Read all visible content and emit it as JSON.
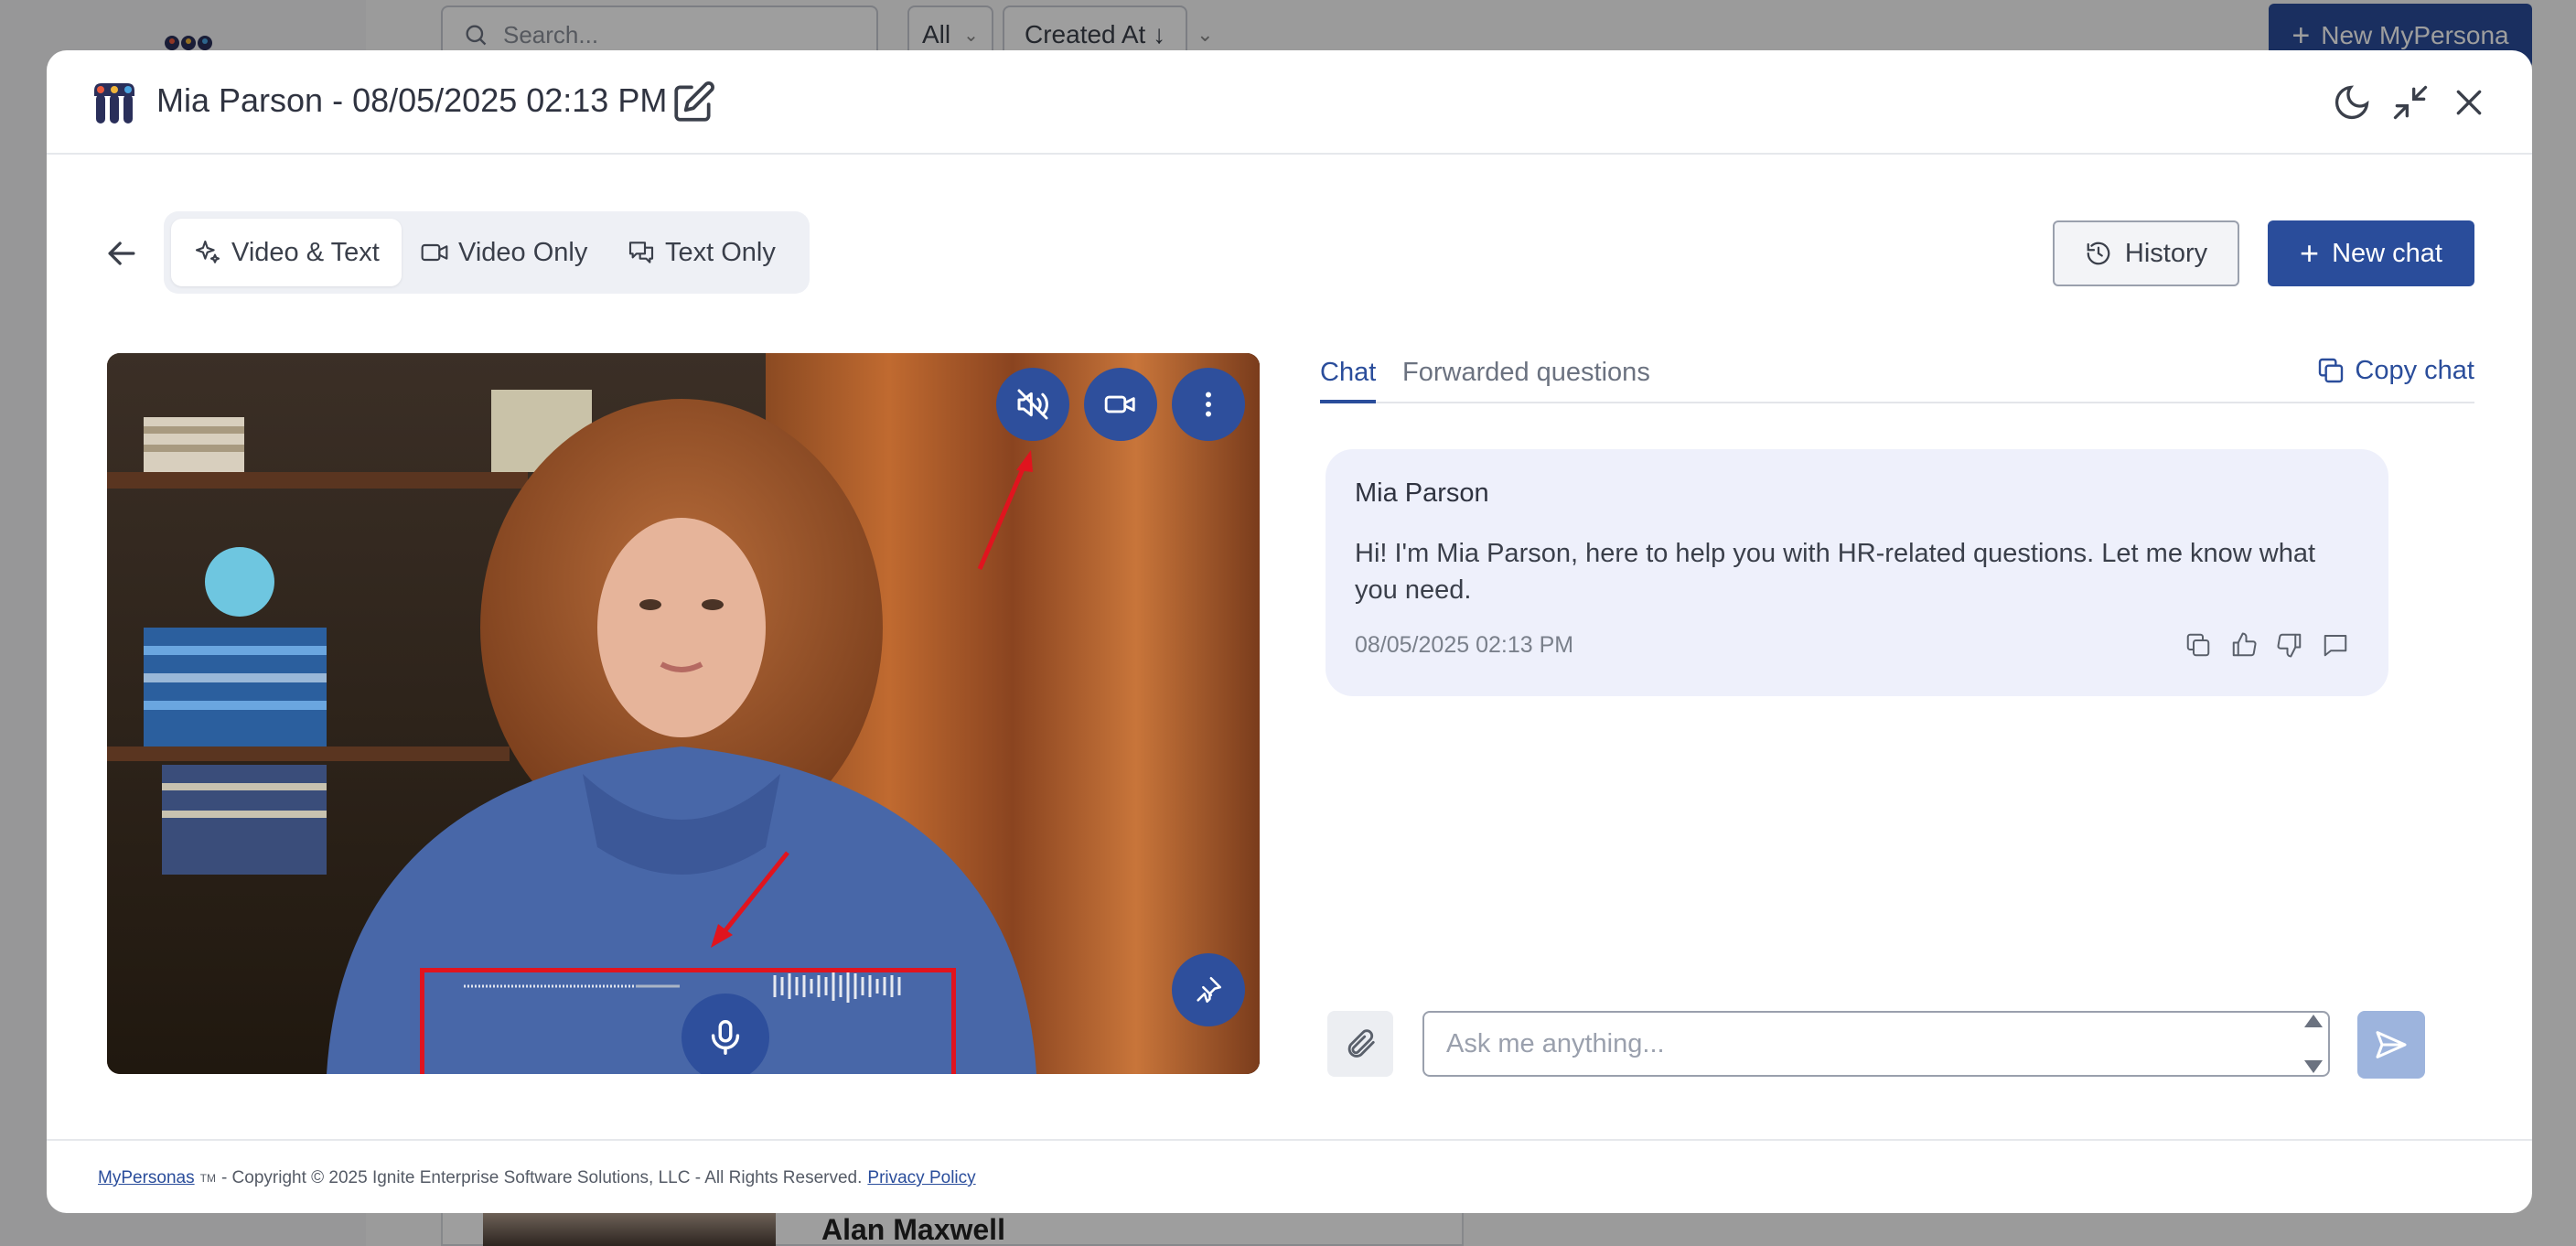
{
  "background": {
    "search_placeholder": "Search...",
    "filter_value": "All",
    "sort_label": "Created At ↓",
    "new_persona_button": "New MyPersona",
    "card_name": "Alan Maxwell"
  },
  "modal": {
    "title": "Mia Parson - 08/05/2025 02:13 PM",
    "icons": {
      "edit": "edit-icon",
      "theme": "moon-icon",
      "minimize": "minimize-icon",
      "close": "close-icon"
    }
  },
  "mode_tabs": [
    {
      "label": "Video & Text",
      "icon": "sparkle-icon",
      "active": true
    },
    {
      "label": "Video Only",
      "icon": "video-icon",
      "active": false
    },
    {
      "label": "Text Only",
      "icon": "chat-bubbles-icon",
      "active": false
    }
  ],
  "toolbar": {
    "history_label": "History",
    "new_chat_label": "New chat"
  },
  "video": {
    "controls": [
      "mute-icon",
      "camera-icon",
      "more-vertical-icon"
    ],
    "mic": "mic-icon",
    "pin": "pin-icon",
    "accent": "#2e4f9c",
    "annotation_color": "#e0141e"
  },
  "chat": {
    "tabs": [
      {
        "label": "Chat",
        "active": true
      },
      {
        "label": "Forwarded questions",
        "active": false
      }
    ],
    "copy_label": "Copy chat",
    "messages": [
      {
        "sender": "Mia Parson",
        "text": "Hi! I'm Mia Parson, here to help you with HR-related questions. Let me know what you need.",
        "time": "08/05/2025 02:13 PM"
      }
    ],
    "input_placeholder": "Ask me anything..."
  },
  "footer": {
    "brand_link": "MyPersonas",
    "tm": "TM",
    "copyright": "- Copyright © 2025 Ignite Enterprise Software Solutions, LLC - All Rights Reserved.",
    "privacy_link": "Privacy Policy"
  },
  "colors": {
    "primary": "#2a4d9b",
    "bubble": "#eef0fb",
    "send_disabled": "#9db4dd"
  }
}
